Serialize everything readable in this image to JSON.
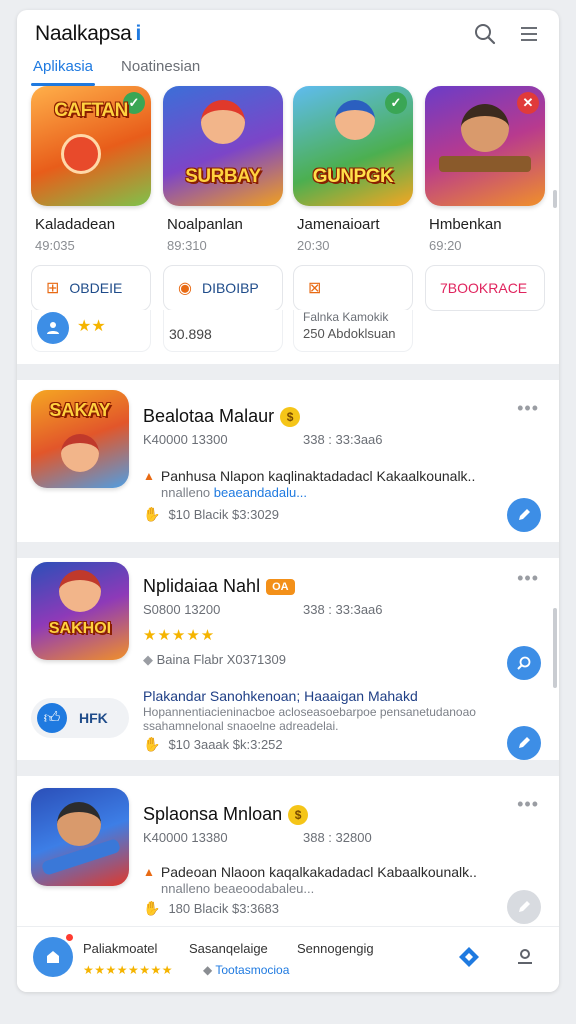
{
  "header": {
    "title": "Naalkapsa",
    "title_mark": "i",
    "tabs": [
      {
        "label": "Aplikasia"
      },
      {
        "label": "Noatinesian"
      }
    ]
  },
  "featured": [
    {
      "art": "CAFTAN",
      "name": "Kaladadean",
      "meta": "49:035",
      "badge_color": "#3aa655"
    },
    {
      "art": "SURBAY",
      "name": "Noalpanlan",
      "meta": "89:310",
      "badge_color": ""
    },
    {
      "art": "GUNPGK",
      "name": "Jamenaioart",
      "meta": "20:30",
      "badge_color": "#3aa655"
    },
    {
      "art": "",
      "name": "Hmbenkan",
      "meta": "69:20",
      "badge_color": "#e03a3a"
    }
  ],
  "chips": [
    {
      "label": "OBDEIE",
      "color": "#1f4c8a"
    },
    {
      "label": "DIBOIBP",
      "color": "#1f4c8a"
    },
    {
      "label": "",
      "color": ""
    },
    {
      "label": "7BOOKRACE",
      "color": "#e0245e"
    }
  ],
  "chip_extras": {
    "value_2": "30.898",
    "line_3a": "Falnka Kamokik",
    "line_3b": "250 Abdoklsuan"
  },
  "cards": [
    {
      "title": "Bealotaa Malaur",
      "left_meta": "K40000 13300",
      "right_meta": "338 : 33:3aa6",
      "desc": "Panhusa Nlapon kaqlinaktadadacl Kakaalkounalk..",
      "desc2_a": "nnalleno ",
      "desc2_b": "beaeandadalu...",
      "stat": "$10  Blacik  $3:3029",
      "icon_word": "SAKAY"
    },
    {
      "title": "Nplidaiaa Nahl",
      "tag": "OA",
      "left_meta": "S0800 13200",
      "right_meta": "338 : 33:3aa6",
      "stars": "★★★★★",
      "sub_meta": "Baina  Flabr  X0371309",
      "desc": "Plakandar Sanohkenoan; Haaaigan Mahakd",
      "desc_sub": "Hopannentiacieninacboe acloseasoebarpoe pensanetudanoao",
      "desc_sub2": "ssahamnelonal snaoelne adreadelai.",
      "pill_label": "HFK",
      "stat": "$10  3aaak  $k:3:252",
      "icon_word": "SAKHOI"
    },
    {
      "title": "Splaonsa Mnloan",
      "left_meta": "K40000 13380",
      "right_meta": "388 : 32800",
      "desc": "Padeoan Nlaoon kaqalkakadadacl Kabaalkounalk..",
      "desc2_a": "nnalleno  beaeoodabaleu...",
      "desc2_b": "",
      "stat": "180  Blacik  $3:3683",
      "icon_word": ""
    }
  ],
  "bottom": {
    "items": [
      "Paliakmoatel",
      "Sasanqelaige",
      "Sennogengig"
    ],
    "stars": "★★★★★★★★",
    "rating_text": "Tootasmocioa"
  }
}
